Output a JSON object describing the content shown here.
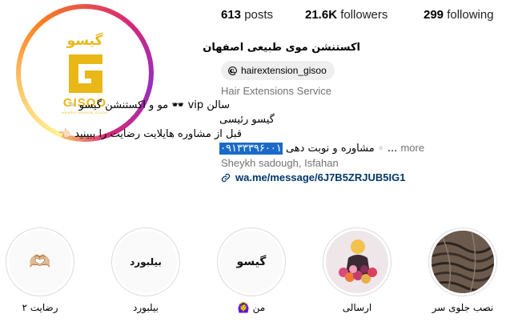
{
  "profile": {
    "logo_arabic": "گیسو",
    "logo_text": "GISOO",
    "logo_sub": "HAIREXTENSION_GISOO"
  },
  "stats": {
    "posts_count": "613",
    "posts_label": "posts",
    "followers_count": "21.6K",
    "followers_label": "followers",
    "following_count": "299",
    "following_label": "following"
  },
  "bio": {
    "name": "اکستنشن موی طبیعی اصفهان",
    "threads_handle": "hairextension_gisoo",
    "category": "Hair Extensions Service",
    "line1": "سالن vip 🕶️ مو و اکستنشن گیسو▫️",
    "line2": "گیسو رئیسی",
    "line3": "قبل از مشاوره هایلایت رضایت را ببینید 👈🏻",
    "line4_text": "▫️مشاوره و نوبت دهی ",
    "line4_phone": "۰۹۱۳۳۳۹۶۰۰۱",
    "line4_ellipsis": "...",
    "more_label": "more",
    "location": "Sheykh sadough, Isfahan",
    "link": "wa.me/message/6J7B5ZRJUB5IG1"
  },
  "highlights": [
    {
      "label": "رضایت ۲",
      "inner": "🫶🏼"
    },
    {
      "label": "بیلبورد",
      "inner": "بیلبورد"
    },
    {
      "label": "من 🙆‍♀️",
      "inner": "گیسو"
    },
    {
      "label": "ارسالی",
      "inner": ""
    },
    {
      "label": "نصب جلوی سر",
      "inner": ""
    }
  ],
  "colors": {
    "logo_gold": "#e9b817",
    "link_blue": "#00376b",
    "highlight_blue": "#1b6ac9",
    "secondary_text": "#737373"
  }
}
